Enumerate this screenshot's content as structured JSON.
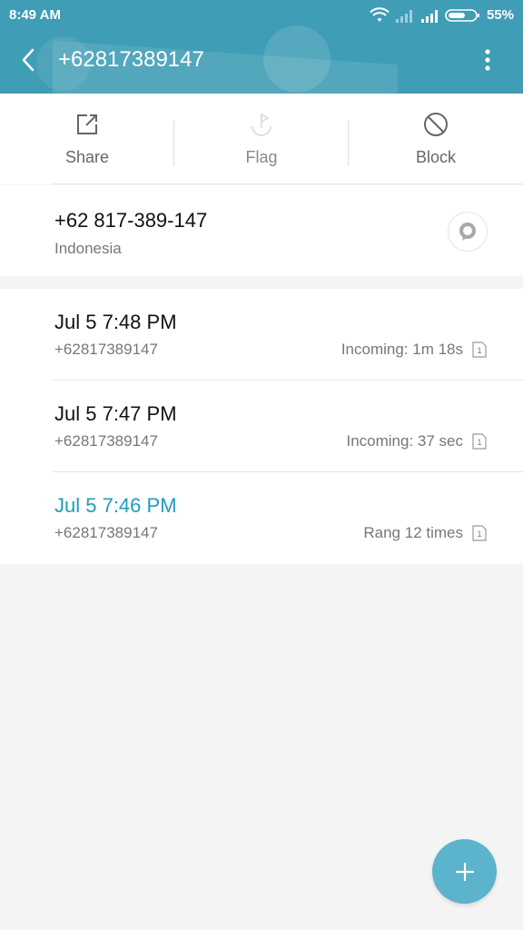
{
  "status_bar": {
    "time": "8:49 AM",
    "battery_percent": "55%",
    "icons": [
      "wifi-icon",
      "signal-icon",
      "signal-icon",
      "battery-icon"
    ]
  },
  "header": {
    "title": "+62817389147",
    "background_color": "#3f9db6",
    "back_icon": "chevron-left-icon",
    "menu_icon": "more-vert-icon"
  },
  "actions": [
    {
      "label": "Share",
      "icon": "share-icon",
      "enabled": true
    },
    {
      "label": "Flag",
      "icon": "flag-icon",
      "enabled": false
    },
    {
      "label": "Block",
      "icon": "block-icon",
      "enabled": true
    }
  ],
  "contact": {
    "number": "+62 817-389-147",
    "region": "Indonesia",
    "message_icon": "message-icon"
  },
  "calls": [
    {
      "when": "Jul 5 7:48 PM",
      "number": "+62817389147",
      "info": "Incoming: 1m 18s",
      "missed": false,
      "sim": "1"
    },
    {
      "when": "Jul 5 7:47 PM",
      "number": "+62817389147",
      "info": "Incoming: 37 sec",
      "missed": false,
      "sim": "1"
    },
    {
      "when": "Jul 5 7:46 PM",
      "number": "+62817389147",
      "info": "Rang 12 times",
      "missed": true,
      "sim": "1"
    }
  ],
  "accent_color": "#1d9dbd",
  "fab": {
    "icon": "plus-icon",
    "color": "#5cb3cc"
  }
}
